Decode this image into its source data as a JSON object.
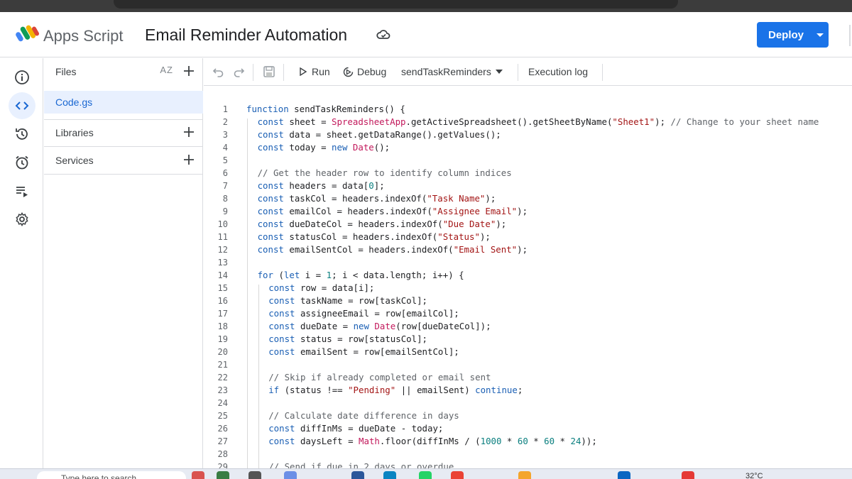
{
  "app": {
    "brand": "Apps Script",
    "project_title": "Email Reminder Automation",
    "deploy_label": "Deploy"
  },
  "rail": {
    "items": [
      {
        "name": "overview",
        "icon": "info-icon"
      },
      {
        "name": "editor",
        "icon": "code-icon",
        "active": true
      },
      {
        "name": "executions",
        "icon": "history-icon"
      },
      {
        "name": "triggers",
        "icon": "alarm-icon"
      },
      {
        "name": "executions-list",
        "icon": "list-play-icon"
      },
      {
        "name": "settings",
        "icon": "gear-icon"
      }
    ]
  },
  "files_panel": {
    "files_label": "Files",
    "sort_label": "AZ",
    "files": [
      "Code.gs"
    ],
    "libraries_label": "Libraries",
    "services_label": "Services"
  },
  "toolbar": {
    "run_label": "Run",
    "debug_label": "Debug",
    "function_select": "sendTaskReminders",
    "execution_log_label": "Execution log"
  },
  "editor": {
    "lines": [
      {
        "n": "1",
        "indent": 0,
        "text": "function sendTaskReminders() {"
      },
      {
        "n": "2",
        "indent": 1,
        "text": "const sheet = SpreadsheetApp.getActiveSpreadsheet().getSheetByName(\"Sheet1\"); // Change to your sheet name"
      },
      {
        "n": "3",
        "indent": 1,
        "text": "const data = sheet.getDataRange().getValues();"
      },
      {
        "n": "4",
        "indent": 1,
        "text": "const today = new Date();"
      },
      {
        "n": "5",
        "indent": 1,
        "text": ""
      },
      {
        "n": "6",
        "indent": 1,
        "text": "// Get the header row to identify column indices"
      },
      {
        "n": "7",
        "indent": 1,
        "text": "const headers = data[0];"
      },
      {
        "n": "8",
        "indent": 1,
        "text": "const taskCol = headers.indexOf(\"Task Name\");"
      },
      {
        "n": "9",
        "indent": 1,
        "text": "const emailCol = headers.indexOf(\"Assignee Email\");"
      },
      {
        "n": "10",
        "indent": 1,
        "text": "const dueDateCol = headers.indexOf(\"Due Date\");"
      },
      {
        "n": "11",
        "indent": 1,
        "text": "const statusCol = headers.indexOf(\"Status\");"
      },
      {
        "n": "12",
        "indent": 1,
        "text": "const emailSentCol = headers.indexOf(\"Email Sent\");"
      },
      {
        "n": "13",
        "indent": 1,
        "text": ""
      },
      {
        "n": "14",
        "indent": 1,
        "text": "for (let i = 1; i < data.length; i++) {"
      },
      {
        "n": "15",
        "indent": 2,
        "text": "const row = data[i];"
      },
      {
        "n": "16",
        "indent": 2,
        "text": "const taskName = row[taskCol];"
      },
      {
        "n": "17",
        "indent": 2,
        "text": "const assigneeEmail = row[emailCol];"
      },
      {
        "n": "18",
        "indent": 2,
        "text": "const dueDate = new Date(row[dueDateCol]);"
      },
      {
        "n": "19",
        "indent": 2,
        "text": "const status = row[statusCol];"
      },
      {
        "n": "20",
        "indent": 2,
        "text": "const emailSent = row[emailSentCol];"
      },
      {
        "n": "21",
        "indent": 2,
        "text": ""
      },
      {
        "n": "22",
        "indent": 2,
        "text": "// Skip if already completed or email sent"
      },
      {
        "n": "23",
        "indent": 2,
        "text": "if (status !== \"Pending\" || emailSent) continue;"
      },
      {
        "n": "24",
        "indent": 2,
        "text": ""
      },
      {
        "n": "25",
        "indent": 2,
        "text": "// Calculate date difference in days"
      },
      {
        "n": "26",
        "indent": 2,
        "text": "const diffInMs = dueDate - today;"
      },
      {
        "n": "27",
        "indent": 2,
        "text": "const daysLeft = Math.floor(diffInMs / (1000 * 60 * 60 * 24));"
      },
      {
        "n": "28",
        "indent": 2,
        "text": ""
      },
      {
        "n": "29",
        "indent": 2,
        "text": "// Send if due in 2 days or overdue"
      }
    ]
  },
  "taskbar": {
    "search_placeholder": "Type here to search",
    "temperature": "32°C"
  },
  "colors": {
    "accent": "#1a73e8",
    "active_bg": "#e8f0fe",
    "keyword": "#1a5fb4",
    "class": "#c2185b",
    "string": "#a31515",
    "number": "#0a7f7f",
    "comment": "#5f6368"
  }
}
